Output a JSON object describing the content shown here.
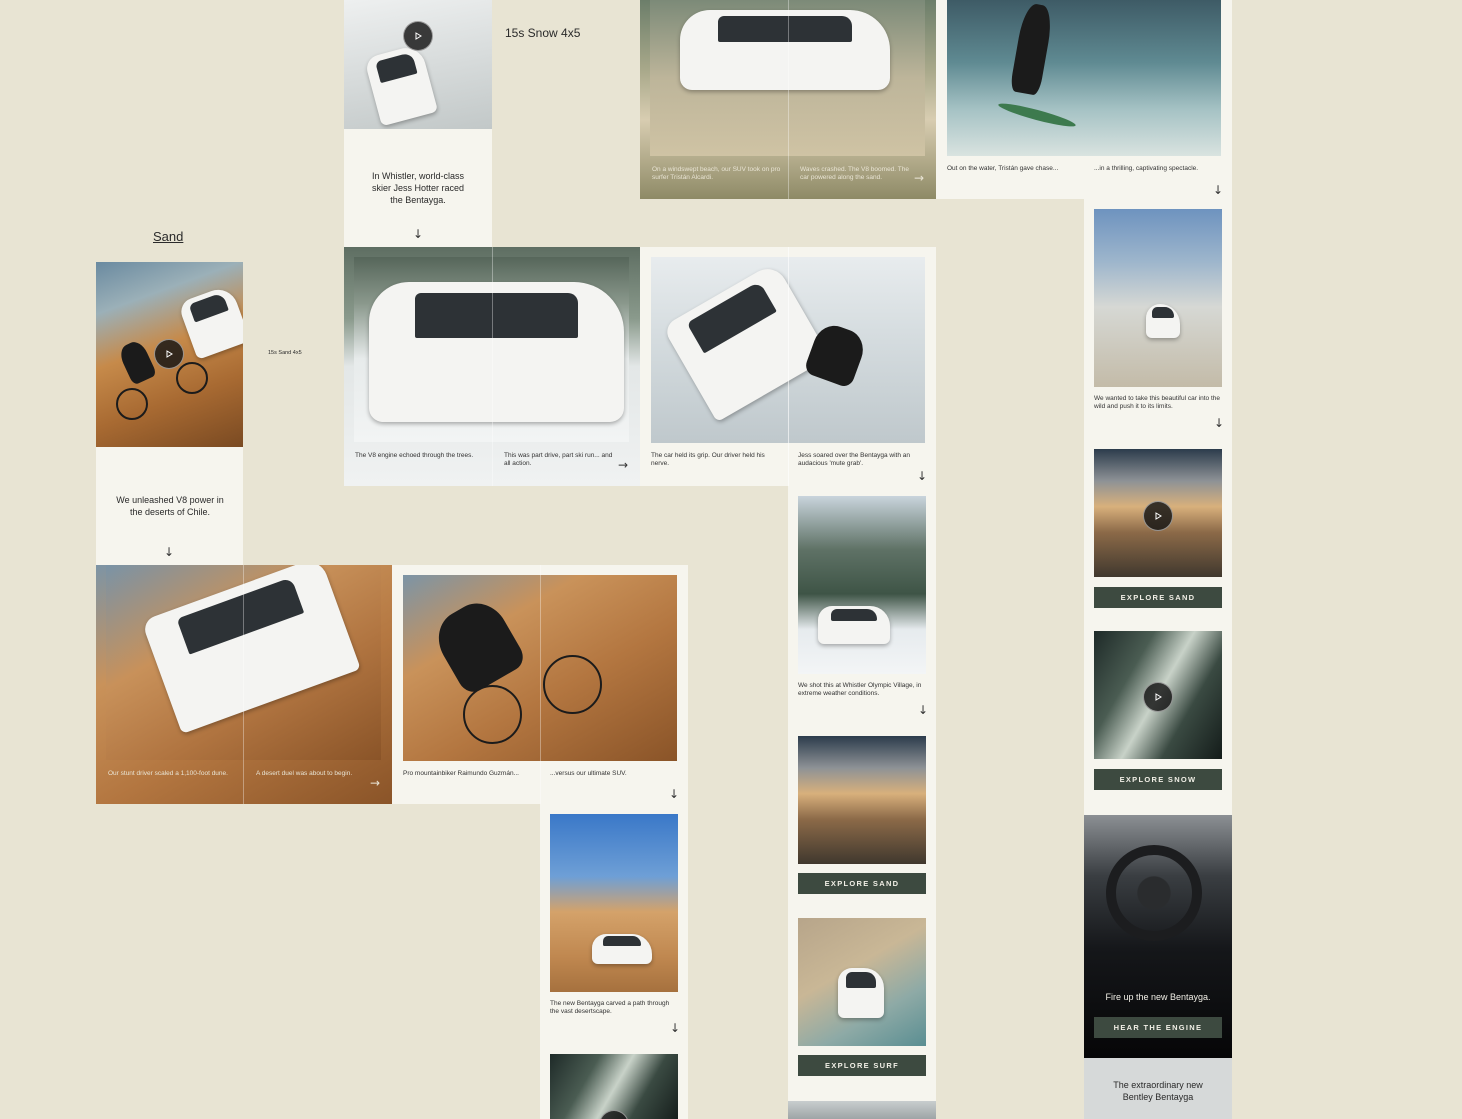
{
  "labels": {
    "snow_section": "15s Snow 4x5",
    "sand_section": "Sand",
    "sand_video": "15s Sand 4x5"
  },
  "snow_intro": {
    "text": "In Whistler, world-class skier Jess Hotter raced the Bentayga."
  },
  "sand_intro": {
    "text": "We unleashed V8 power in the deserts of Chile."
  },
  "beach_carousel": {
    "caption_1": "On a windswept beach, our SUV took on pro surfer Tristán Alcardi.",
    "caption_2": "Waves crashed. The V8 boomed. The car powered along the sand."
  },
  "surf_carousel": {
    "caption_1": "Out on the water, Tristán gave chase...",
    "caption_2": "...in a thrilling, captivating spectacle."
  },
  "snow_carousel_1": {
    "caption_1": "The V8 engine echoed through the trees.",
    "caption_2": "This was part drive, part ski run... and all action."
  },
  "snow_carousel_2": {
    "caption_1": "The car held its grip. Our driver held his nerve.",
    "caption_2": "Jess soared over the Bentayga with an audacious 'mute grab'."
  },
  "snow_single": {
    "caption": "We shot this at Whistler Olympic Village, in extreme weather conditions."
  },
  "sand_carousel_1": {
    "caption_1": "Our stunt driver scaled a 1,100-foot dune.",
    "caption_2": "A desert duel was about to begin."
  },
  "sand_carousel_2": {
    "caption_1": "Pro mountainbiker Raimundo Guzmán...",
    "caption_2": "...versus our ultimate SUV."
  },
  "sand_single": {
    "caption": "The new Bentayga carved a path through the vast desertscape."
  },
  "surf_single": {
    "caption": "We wanted to take this beautiful car into the wild and push it to its limits."
  },
  "buttons": {
    "explore_sand": "EXPLORE SAND",
    "explore_snow": "EXPLORE SNOW",
    "explore_surf": "EXPLORE SURF",
    "hear_engine": "HEAR THE ENGINE"
  },
  "engine_card": {
    "text": "Fire up the new Bentayga."
  },
  "final_card": {
    "text": "The extraordinary new Bentley Bentayga"
  },
  "icons": {
    "play": "play-icon",
    "arrow_down": "arrow-down-icon",
    "arrow_right": "arrow-right-icon"
  },
  "colors": {
    "background": "#e8e4d3",
    "card": "#f6f5ee",
    "button": "#3d4a40"
  }
}
